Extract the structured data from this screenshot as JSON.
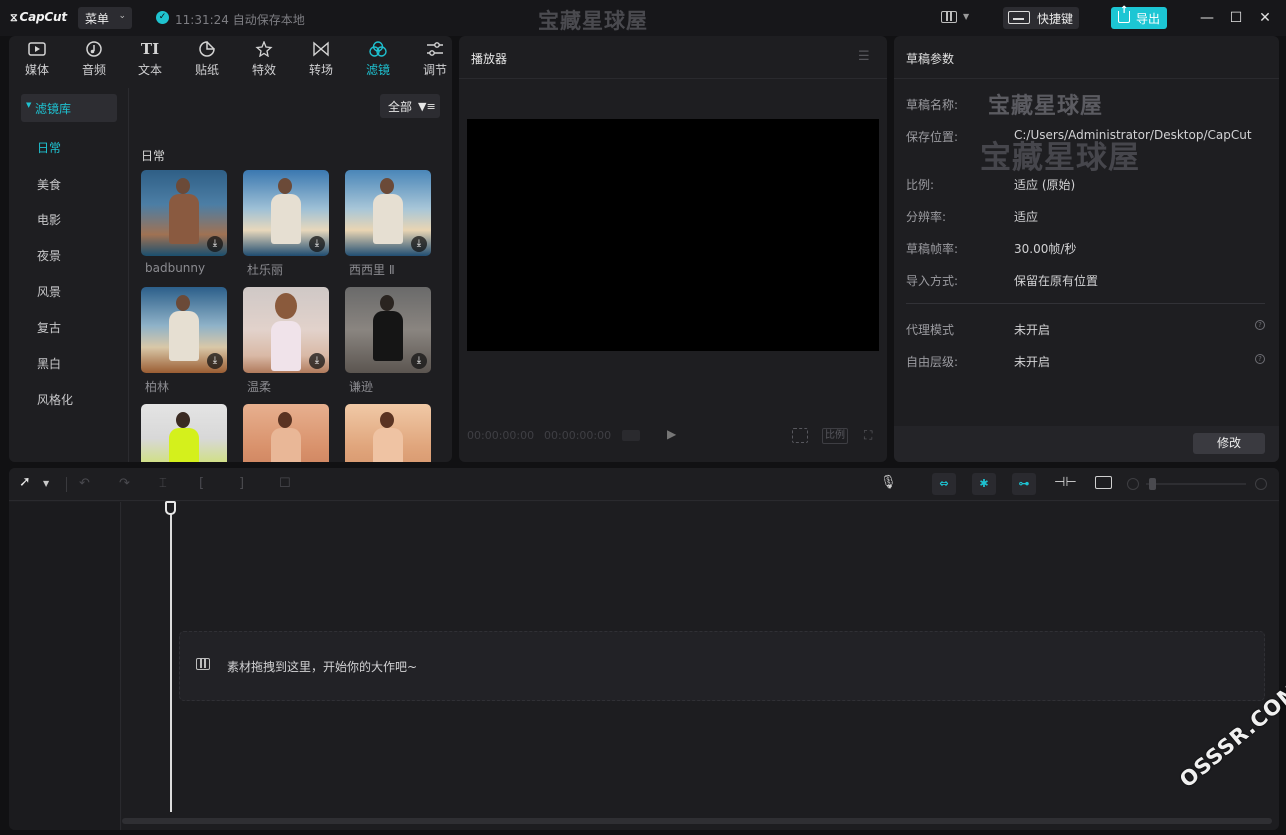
{
  "app": {
    "logo_text": "CapCut",
    "menu_label": "菜单",
    "save_status": "11:31:24 自动保存本地",
    "watermark_title": "宝藏星球屋",
    "shortcut_label": "快捷键",
    "export_label": "导出"
  },
  "window_controls": {
    "minimize": "—",
    "maximize": "☐",
    "close": "✕"
  },
  "tabs": [
    {
      "label": "媒体",
      "icon": "media-icon"
    },
    {
      "label": "音频",
      "icon": "audio-icon"
    },
    {
      "label": "文本",
      "icon": "text-icon"
    },
    {
      "label": "贴纸",
      "icon": "sticker-icon"
    },
    {
      "label": "特效",
      "icon": "effects-icon"
    },
    {
      "label": "转场",
      "icon": "transition-icon"
    },
    {
      "label": "滤镜",
      "icon": "filter-icon",
      "active": true
    },
    {
      "label": "调节",
      "icon": "adjust-icon"
    }
  ],
  "filter_library": {
    "header": "滤镜库",
    "categories": [
      "日常",
      "美食",
      "电影",
      "夜景",
      "风景",
      "复古",
      "黑白",
      "风格化"
    ],
    "active_category": "日常",
    "filter_all": "全部",
    "section_title": "日常",
    "items": [
      {
        "label": "badbunny"
      },
      {
        "label": "杜乐丽"
      },
      {
        "label": "西西里 Ⅱ"
      },
      {
        "label": "柏林"
      },
      {
        "label": "温柔"
      },
      {
        "label": "谦逊"
      }
    ]
  },
  "player": {
    "title": "播放器",
    "time_current": "00:00:00:00",
    "time_total": "00:00:00:00",
    "ratio_label": "比例"
  },
  "draft": {
    "title": "草稿参数",
    "rows": [
      {
        "key": "草稿名称:",
        "value": ""
      },
      {
        "key": "保存位置:",
        "value": "C:/Users/Administrator/Desktop/CapCut"
      },
      {
        "key": "比例:",
        "value": "适应 (原始)"
      },
      {
        "key": "分辨率:",
        "value": "适应"
      },
      {
        "key": "草稿帧率:",
        "value": "30.00帧/秒"
      },
      {
        "key": "导入方式:",
        "value": "保留在原有位置"
      }
    ],
    "rows2": [
      {
        "key": "代理模式",
        "value": "未开启"
      },
      {
        "key": "自由层级:",
        "value": "未开启"
      }
    ],
    "watermark_name": "宝藏星球屋",
    "watermark_path": "宝藏星球屋",
    "modify_label": "修改"
  },
  "timeline": {
    "drop_hint": "素材拖拽到这里，开始你的大作吧~"
  },
  "site_watermark": "OSSSR.COM",
  "colors": {
    "accent": "#1ec2d1",
    "panel": "#1e1e21",
    "background": "#111113"
  }
}
